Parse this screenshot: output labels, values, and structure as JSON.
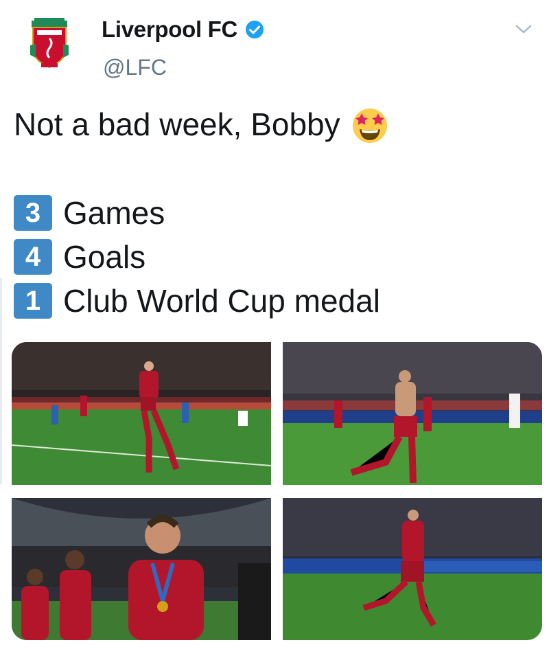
{
  "account": {
    "display_name": "Liverpool FC",
    "handle": "@LFC",
    "verified": true,
    "avatar_icon": "liverpool-crest-icon"
  },
  "tweet": {
    "text_line": "Not a bad week, Bobby",
    "text_emoji": "star-struck-emoji",
    "stats": [
      {
        "number": "3",
        "label": "Games"
      },
      {
        "number": "4",
        "label": "Goals"
      },
      {
        "number": "1",
        "label": "Club World Cup medal"
      }
    ]
  },
  "media": {
    "photos": [
      {
        "name": "celebration-run-photo"
      },
      {
        "name": "shirtless-celebration-photo"
      },
      {
        "name": "medal-celebration-photo"
      },
      {
        "name": "goal-run-photo"
      }
    ]
  },
  "colors": {
    "keycap_blue": "#3f8ac6",
    "verified_blue": "#1da1f2",
    "handle_grey": "#657786",
    "liverpool_red": "#c8102e"
  }
}
